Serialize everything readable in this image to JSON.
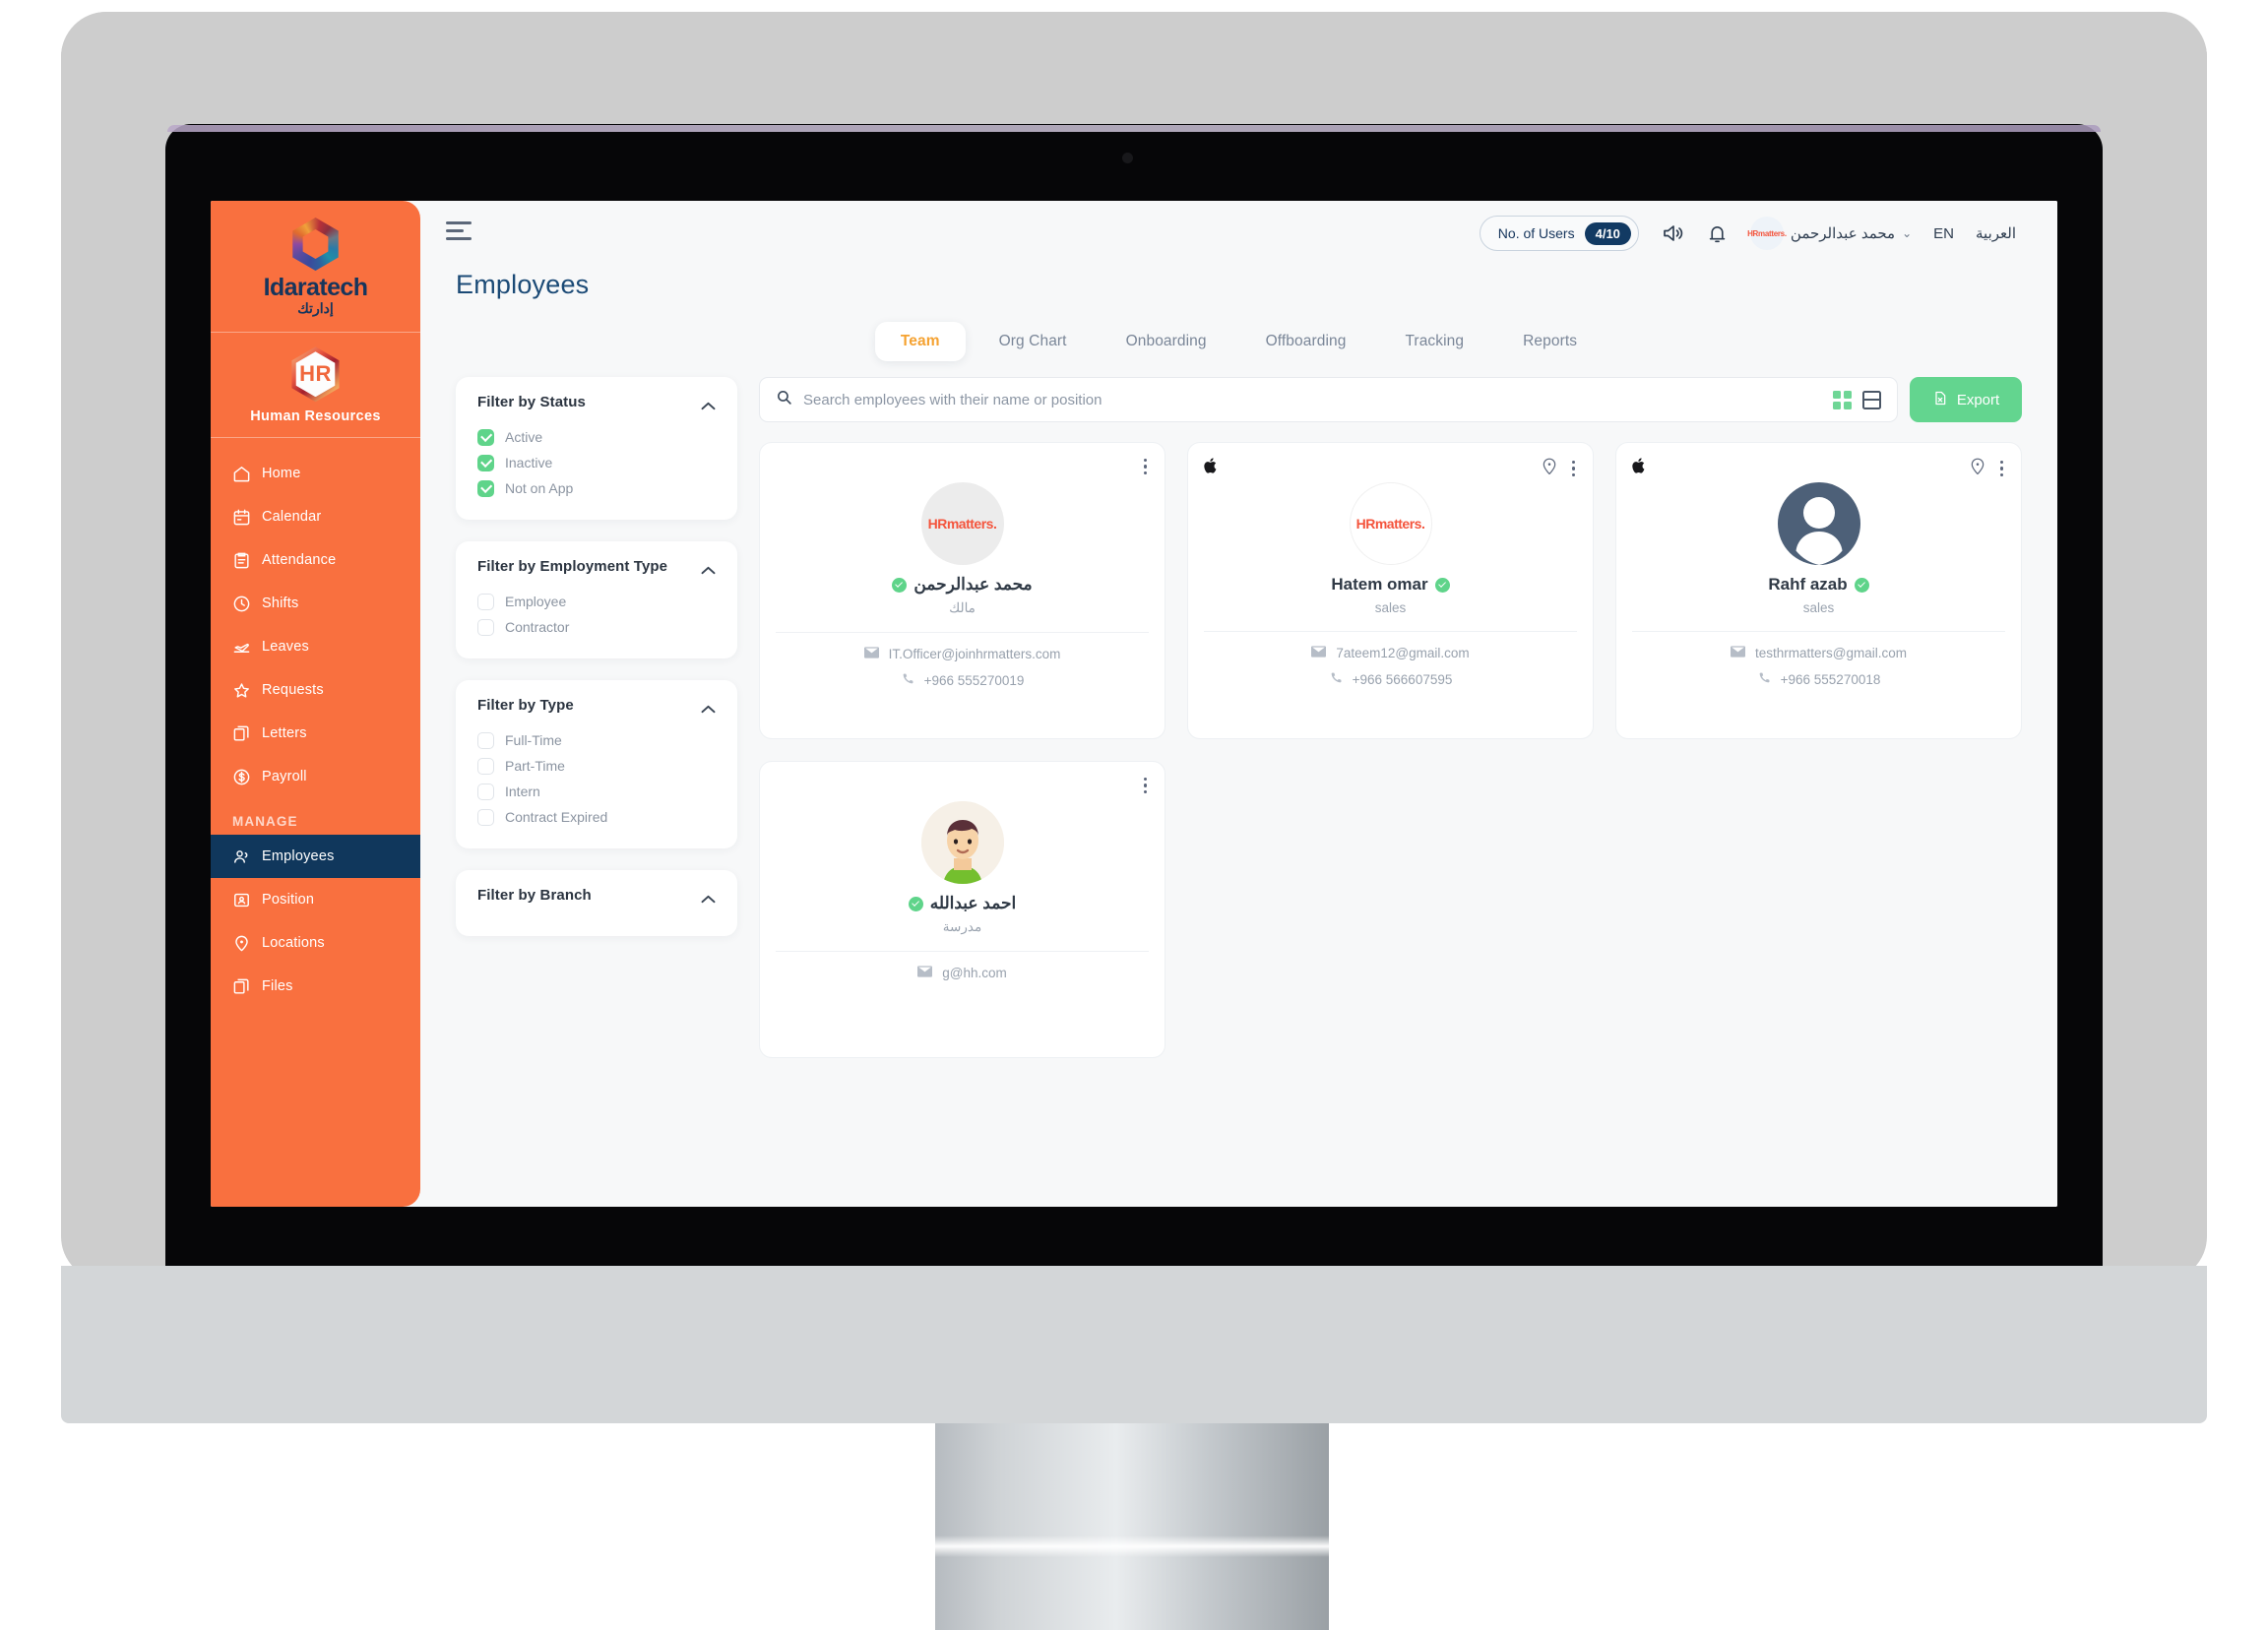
{
  "sidebar": {
    "brand_name": "Idaratech",
    "brand_name_ar": "إدارتك",
    "module_badge": "HR",
    "module_label": "Human Resources",
    "section_label": "MANAGE",
    "items": [
      {
        "label": "Home",
        "icon": "home-icon"
      },
      {
        "label": "Calendar",
        "icon": "calendar-icon"
      },
      {
        "label": "Attendance",
        "icon": "clipboard-icon"
      },
      {
        "label": "Shifts",
        "icon": "clock-icon"
      },
      {
        "label": "Leaves",
        "icon": "plane-icon"
      },
      {
        "label": "Requests",
        "icon": "star-icon"
      },
      {
        "label": "Letters",
        "icon": "documents-icon"
      },
      {
        "label": "Payroll",
        "icon": "dollar-icon"
      }
    ],
    "manage_items": [
      {
        "label": "Employees",
        "icon": "people-icon",
        "active": true
      },
      {
        "label": "Position",
        "icon": "id-card-icon",
        "active": false
      },
      {
        "label": "Locations",
        "icon": "pin-icon",
        "active": false
      },
      {
        "label": "Files",
        "icon": "files-icon",
        "active": false
      }
    ]
  },
  "topbar": {
    "menu_icon": "hamburger-icon",
    "users_label": "No. of Users",
    "users_count": "4/10",
    "announcement_icon": "megaphone-icon",
    "notification_icon": "bell-icon",
    "user_name": "محمد عبدالرحمن",
    "user_avatar_text": "HRmatters.",
    "chevron": "⌄",
    "lang_en": "EN",
    "lang_ar": "العربية"
  },
  "page": {
    "title": "Employees"
  },
  "tabs": [
    {
      "label": "Team",
      "active": true
    },
    {
      "label": "Org Chart",
      "active": false
    },
    {
      "label": "Onboarding",
      "active": false
    },
    {
      "label": "Offboarding",
      "active": false
    },
    {
      "label": "Tracking",
      "active": false
    },
    {
      "label": "Reports",
      "active": false
    }
  ],
  "filters": [
    {
      "title": "Filter by Status",
      "collapse_icon": "chevron-up-icon",
      "options": [
        {
          "label": "Active",
          "checked": true
        },
        {
          "label": "Inactive",
          "checked": true
        },
        {
          "label": "Not on App",
          "checked": true
        }
      ]
    },
    {
      "title": "Filter by Employment Type",
      "collapse_icon": "chevron-up-icon",
      "options": [
        {
          "label": "Employee",
          "checked": false
        },
        {
          "label": "Contractor",
          "checked": false
        }
      ]
    },
    {
      "title": "Filter by Type",
      "collapse_icon": "chevron-up-icon",
      "options": [
        {
          "label": "Full-Time",
          "checked": false
        },
        {
          "label": "Part-Time",
          "checked": false
        },
        {
          "label": "Intern",
          "checked": false
        },
        {
          "label": "Contract Expired",
          "checked": false
        }
      ]
    },
    {
      "title": "Filter by Branch",
      "collapse_icon": "chevron-up-icon",
      "options": []
    }
  ],
  "toolbar": {
    "search_placeholder": "Search employees with their name or position",
    "search_value": "",
    "search_icon": "search-icon",
    "grid_view_icon": "grid-view-icon",
    "list_view_icon": "list-view-icon",
    "export_label": "Export",
    "export_icon": "export-file-icon"
  },
  "employees": [
    {
      "name": "محمد عبدالرحمن",
      "rtl": true,
      "role": "مالك",
      "role_rtl": true,
      "email": "IT.Officer@joinhrmatters.com",
      "phone": "+966 555270019",
      "verified": true,
      "avatar_type": "grey-logo",
      "avatar_text": "HRmatters.",
      "has_apple": false,
      "has_location": false
    },
    {
      "name": "Hatem omar",
      "rtl": false,
      "role": "sales",
      "role_rtl": false,
      "email": "7ateem12@gmail.com",
      "phone": "+966 566607595",
      "verified": true,
      "avatar_type": "ring-logo",
      "avatar_text": "HRmatters.",
      "has_apple": true,
      "has_location": true
    },
    {
      "name": "Rahf azab",
      "rtl": false,
      "role": "sales",
      "role_rtl": false,
      "email": "testhrmatters@gmail.com",
      "phone": "+966 555270018",
      "verified": true,
      "avatar_type": "silhouette",
      "avatar_text": "",
      "has_apple": true,
      "has_location": true
    },
    {
      "name": "احمد عبدالله",
      "rtl": true,
      "role": "مدرسة",
      "role_rtl": true,
      "email": "g@hh.com",
      "phone": "",
      "verified": true,
      "avatar_type": "cartoon",
      "avatar_text": "",
      "has_apple": false,
      "has_location": false
    }
  ],
  "colors": {
    "sidebar_orange": "#f9703f",
    "active_navy": "#10375c",
    "accent_green": "#63d58f",
    "title_blue": "#1b4a76",
    "tab_active_orange": "#f5a231",
    "brand_red": "#f4543c"
  }
}
